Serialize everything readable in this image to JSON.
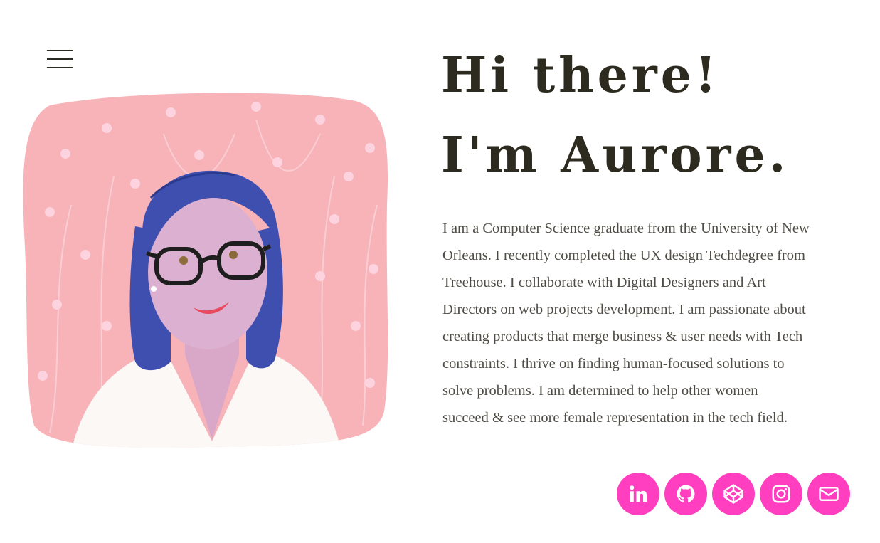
{
  "nav": {
    "menu_icon": "hamburger-menu-icon"
  },
  "portrait": {
    "description_icon": "illustrated-portrait"
  },
  "hero": {
    "line1": "Hi there!",
    "line2": "I'm Aurore."
  },
  "bio": {
    "lines": [
      "I am a Computer Science graduate from the University of New",
      "Orleans. I recently completed the UX design Techdegree from",
      "Treehouse. I collaborate with Digital Designers and Art",
      "Directors on web projects development. I am passionate about",
      "creating products that merge business & user needs with Tech",
      "constraints. I thrive on finding human-focused solutions to",
      "solve problems. I am determined to help other women",
      "succeed & see more female representation in the tech field."
    ]
  },
  "social": {
    "accent_color": "#ff3fc0",
    "links": [
      {
        "icon": "linkedin-icon"
      },
      {
        "icon": "github-icon"
      },
      {
        "icon": "codepen-icon"
      },
      {
        "icon": "instagram-icon"
      },
      {
        "icon": "email-icon"
      }
    ]
  },
  "colors": {
    "heading": "#2d2b1f",
    "body_text": "#4e4c44",
    "portrait_bg": "#f7b3b8",
    "hair": "#3f4fb0"
  }
}
